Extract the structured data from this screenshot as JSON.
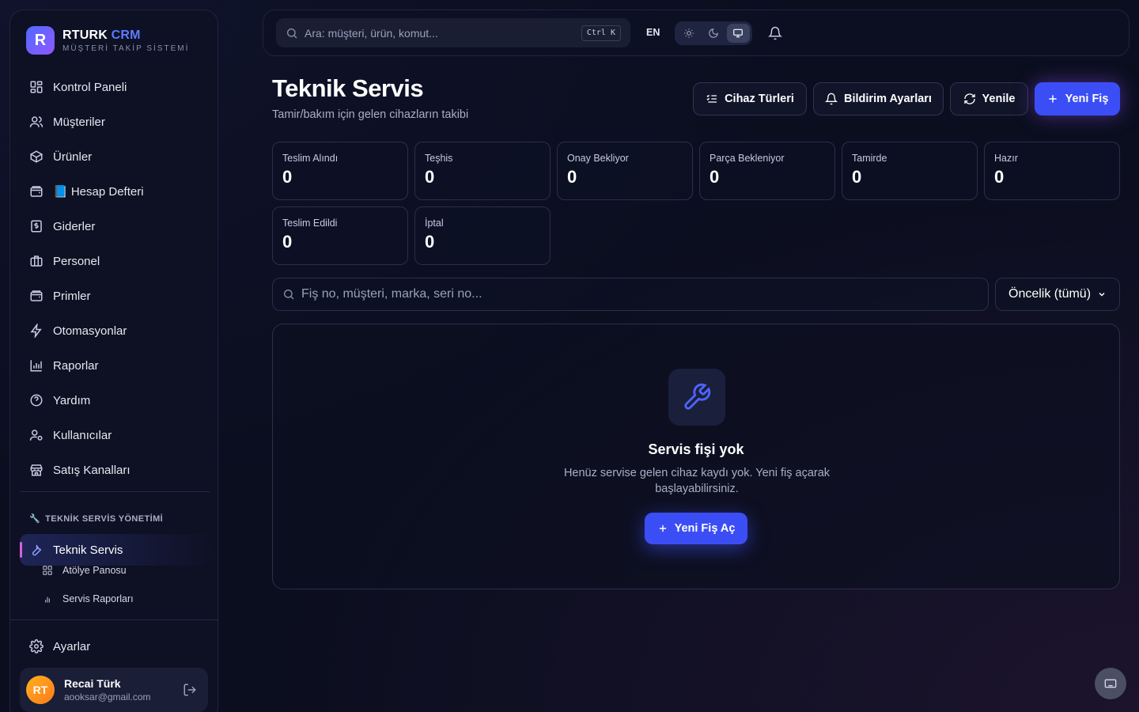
{
  "brand": {
    "logo_letter": "R",
    "name_part1": "RTURK",
    "name_part2": "CRM",
    "subtitle": "MÜŞTERİ TAKİP SİSTEMİ"
  },
  "sidebar": {
    "items": [
      {
        "label": "Kontrol Paneli",
        "icon": "dashboard-icon"
      },
      {
        "label": "Müşteriler",
        "icon": "users-icon"
      },
      {
        "label": "Ürünler",
        "icon": "box-icon"
      },
      {
        "label": "📘 Hesap Defteri",
        "icon": "wallet-icon"
      },
      {
        "label": "Giderler",
        "icon": "receipt-icon"
      },
      {
        "label": "Personel",
        "icon": "briefcase-icon"
      },
      {
        "label": "Primler",
        "icon": "wallet-icon"
      },
      {
        "label": "Otomasyonlar",
        "icon": "zap-icon"
      },
      {
        "label": "Raporlar",
        "icon": "bar-chart-icon"
      },
      {
        "label": "Yardım",
        "icon": "help-icon"
      },
      {
        "label": "Kullanıcılar",
        "icon": "user-cog-icon"
      },
      {
        "label": "Satış Kanalları",
        "icon": "store-icon"
      }
    ],
    "section_label": "TEKNİK SERVİS YÖNETİMİ",
    "section_emoji": "🔧",
    "active_item": "Teknik Servis",
    "sub_items": [
      {
        "label": "Atölye Panosu",
        "icon": "grid-icon"
      },
      {
        "label": "Servis Raporları",
        "icon": "bar-chart-icon"
      }
    ],
    "settings_label": "Ayarlar",
    "user": {
      "initials": "RT",
      "name": "Recai Türk",
      "email": "aooksar@gmail.com"
    }
  },
  "topbar": {
    "search_placeholder": "Ara: müşteri, ürün, komut...",
    "shortcut": "Ctrl K",
    "language": "EN",
    "theme_modes": [
      "light",
      "dark",
      "system"
    ],
    "active_theme": "system"
  },
  "header": {
    "title": "Teknik Servis",
    "subtitle": "Tamir/bakım için gelen cihazların takibi",
    "buttons": {
      "device_types": "Cihaz Türleri",
      "notification_settings": "Bildirim Ayarları",
      "refresh": "Yenile",
      "new_ticket": "Yeni Fiş"
    }
  },
  "stats": [
    {
      "label": "Teslim Alındı",
      "value": "0"
    },
    {
      "label": "Teşhis",
      "value": "0"
    },
    {
      "label": "Onay Bekliyor",
      "value": "0"
    },
    {
      "label": "Parça Bekleniyor",
      "value": "0"
    },
    {
      "label": "Tamirde",
      "value": "0"
    },
    {
      "label": "Hazır",
      "value": "0"
    },
    {
      "label": "Teslim Edildi",
      "value": "0"
    },
    {
      "label": "İptal",
      "value": "0"
    }
  ],
  "filters": {
    "search_placeholder": "Fiş no, müşteri, marka, seri no...",
    "priority_value": "Öncelik (tümü)"
  },
  "empty_state": {
    "title": "Servis fişi yok",
    "text": "Henüz servise gelen cihaz kaydı yok. Yeni fiş açarak başlayabilirsiniz.",
    "button": "Yeni Fiş Aç"
  },
  "colors": {
    "accent": "#3b4ef5",
    "background": "#0b0e1f",
    "active_indicator": "#d45fe0"
  }
}
